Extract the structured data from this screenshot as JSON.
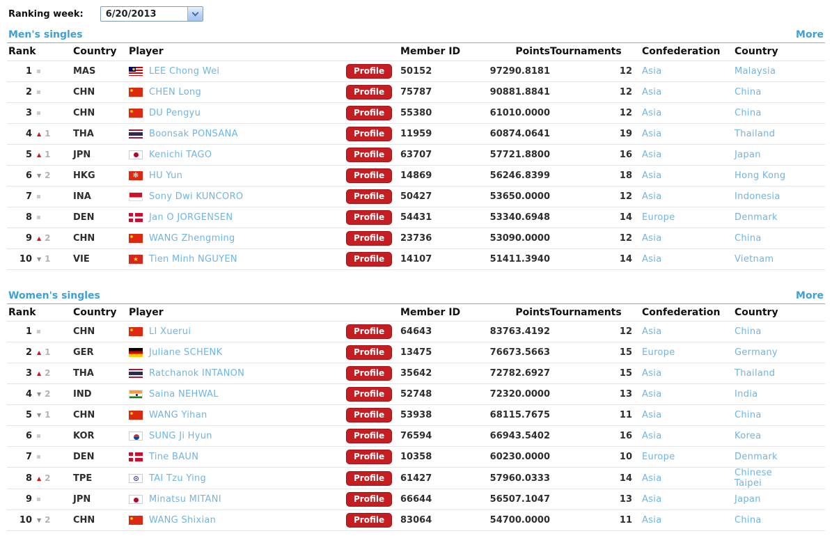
{
  "toolbar": {
    "ranking_week_label": "Ranking week:",
    "selected_week": "6/20/2013"
  },
  "colors": {
    "accent_blue": "#3fa0d8",
    "link_blue": "#6fb5e4",
    "profile_red": "#c51e22",
    "up_arrow": "#cf1616",
    "down_arrow": "#8f8a8a"
  },
  "sections": [
    {
      "id": "mens-singles",
      "title": "Men's singles",
      "more_label": "More",
      "profile_label": "Profile",
      "columns": [
        "Rank",
        "Country",
        "Player",
        "Member ID",
        "Points",
        "Tournaments",
        "Confederation",
        "Country"
      ],
      "rows": [
        {
          "rank": "1",
          "move": "same",
          "delta": "",
          "code": "MAS",
          "player": "LEE Chong Wei",
          "member_id": "50152",
          "points": "97290.8181",
          "tournaments": "12",
          "confederation": "Asia",
          "country": "Malaysia"
        },
        {
          "rank": "2",
          "move": "same",
          "delta": "",
          "code": "CHN",
          "player": "CHEN Long",
          "member_id": "75787",
          "points": "90881.8841",
          "tournaments": "12",
          "confederation": "Asia",
          "country": "China"
        },
        {
          "rank": "3",
          "move": "same",
          "delta": "",
          "code": "CHN",
          "player": "DU Pengyu",
          "member_id": "55380",
          "points": "61010.0000",
          "tournaments": "12",
          "confederation": "Asia",
          "country": "China"
        },
        {
          "rank": "4",
          "move": "up",
          "delta": "1",
          "code": "THA",
          "player": "Boonsak PONSANA",
          "member_id": "11959",
          "points": "60874.0641",
          "tournaments": "19",
          "confederation": "Asia",
          "country": "Thailand"
        },
        {
          "rank": "5",
          "move": "up",
          "delta": "1",
          "code": "JPN",
          "player": "Kenichi TAGO",
          "member_id": "63707",
          "points": "57721.8800",
          "tournaments": "16",
          "confederation": "Asia",
          "country": "Japan"
        },
        {
          "rank": "6",
          "move": "down",
          "delta": "2",
          "code": "HKG",
          "player": "HU Yun",
          "member_id": "14869",
          "points": "56246.8399",
          "tournaments": "18",
          "confederation": "Asia",
          "country": "Hong Kong"
        },
        {
          "rank": "7",
          "move": "same",
          "delta": "",
          "code": "INA",
          "player": "Sony Dwi KUNCORO",
          "member_id": "50427",
          "points": "53650.0000",
          "tournaments": "12",
          "confederation": "Asia",
          "country": "Indonesia"
        },
        {
          "rank": "8",
          "move": "same",
          "delta": "",
          "code": "DEN",
          "player": "Jan O JORGENSEN",
          "member_id": "54431",
          "points": "53340.6948",
          "tournaments": "14",
          "confederation": "Europe",
          "country": "Denmark"
        },
        {
          "rank": "9",
          "move": "up",
          "delta": "2",
          "code": "CHN",
          "player": "WANG Zhengming",
          "member_id": "23736",
          "points": "53090.0000",
          "tournaments": "12",
          "confederation": "Asia",
          "country": "China"
        },
        {
          "rank": "10",
          "move": "down",
          "delta": "1",
          "code": "VIE",
          "player": "Tien Minh NGUYEN",
          "member_id": "14107",
          "points": "51411.3940",
          "tournaments": "14",
          "confederation": "Asia",
          "country": "Vietnam"
        }
      ]
    },
    {
      "id": "womens-singles",
      "title": "Women's singles",
      "more_label": "More",
      "profile_label": "Profile",
      "columns": [
        "Rank",
        "Country",
        "Player",
        "Member ID",
        "Points",
        "Tournaments",
        "Confederation",
        "Country"
      ],
      "rows": [
        {
          "rank": "1",
          "move": "same",
          "delta": "",
          "code": "CHN",
          "player": "LI Xuerui",
          "member_id": "64643",
          "points": "83763.4192",
          "tournaments": "12",
          "confederation": "Asia",
          "country": "China"
        },
        {
          "rank": "2",
          "move": "up",
          "delta": "1",
          "code": "GER",
          "player": "Juliane SCHENK",
          "member_id": "13475",
          "points": "76673.5663",
          "tournaments": "15",
          "confederation": "Europe",
          "country": "Germany"
        },
        {
          "rank": "3",
          "move": "up",
          "delta": "2",
          "code": "THA",
          "player": "Ratchanok INTANON",
          "member_id": "35642",
          "points": "72782.6927",
          "tournaments": "15",
          "confederation": "Asia",
          "country": "Thailand"
        },
        {
          "rank": "4",
          "move": "down",
          "delta": "2",
          "code": "IND",
          "player": "Saina NEHWAL",
          "member_id": "52748",
          "points": "72320.0000",
          "tournaments": "13",
          "confederation": "Asia",
          "country": "India"
        },
        {
          "rank": "5",
          "move": "down",
          "delta": "1",
          "code": "CHN",
          "player": "WANG Yihan",
          "member_id": "53938",
          "points": "68115.7675",
          "tournaments": "11",
          "confederation": "Asia",
          "country": "China"
        },
        {
          "rank": "6",
          "move": "same",
          "delta": "",
          "code": "KOR",
          "player": "SUNG Ji Hyun",
          "member_id": "76594",
          "points": "66943.5402",
          "tournaments": "16",
          "confederation": "Asia",
          "country": "Korea"
        },
        {
          "rank": "7",
          "move": "same",
          "delta": "",
          "code": "DEN",
          "player": "Tine BAUN",
          "member_id": "10358",
          "points": "60230.0000",
          "tournaments": "10",
          "confederation": "Europe",
          "country": "Denmark"
        },
        {
          "rank": "8",
          "move": "up",
          "delta": "2",
          "code": "TPE",
          "player": "TAI Tzu Ying",
          "member_id": "61427",
          "points": "57960.0333",
          "tournaments": "14",
          "confederation": "Asia",
          "country": "Chinese Taipei"
        },
        {
          "rank": "9",
          "move": "same",
          "delta": "",
          "code": "JPN",
          "player": "Minatsu MITANI",
          "member_id": "66644",
          "points": "56507.1047",
          "tournaments": "13",
          "confederation": "Asia",
          "country": "Japan"
        },
        {
          "rank": "10",
          "move": "down",
          "delta": "2",
          "code": "CHN",
          "player": "WANG Shixian",
          "member_id": "83064",
          "points": "54700.0000",
          "tournaments": "11",
          "confederation": "Asia",
          "country": "China"
        }
      ]
    }
  ]
}
